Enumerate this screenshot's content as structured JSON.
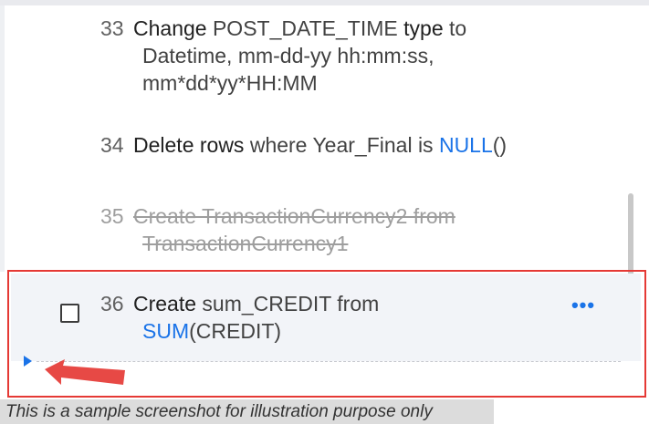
{
  "steps": [
    {
      "number": "33",
      "keyword": "Change",
      "text_a": " POST_DATE_TIME ",
      "keyword2": "type",
      "text_b": " to",
      "line2": "Datetime, mm-dd-yy hh:mm:ss,",
      "line3": "mm*dd*yy*HH:MM"
    },
    {
      "number": "34",
      "keyword": "Delete rows",
      "text_a": " where Year_Final is ",
      "function": "NULL",
      "text_b": "()"
    },
    {
      "number": "35",
      "line1": "Create TransactionCurrency2 from",
      "line2": "TransactionCurrency1",
      "status": "deleted"
    },
    {
      "number": "36",
      "keyword": "Create",
      "text_a": " sum_CREDIT from",
      "function": "SUM",
      "text_b": "(CREDIT)",
      "checked": false,
      "more_icon": "more-horizontal-icon"
    }
  ],
  "caption": "This is a sample screenshot for illustration purpose only",
  "colors": {
    "function_blue": "#1a73e8",
    "highlight_red": "#e53935",
    "selected_row_bg": "#f2f4f8"
  }
}
